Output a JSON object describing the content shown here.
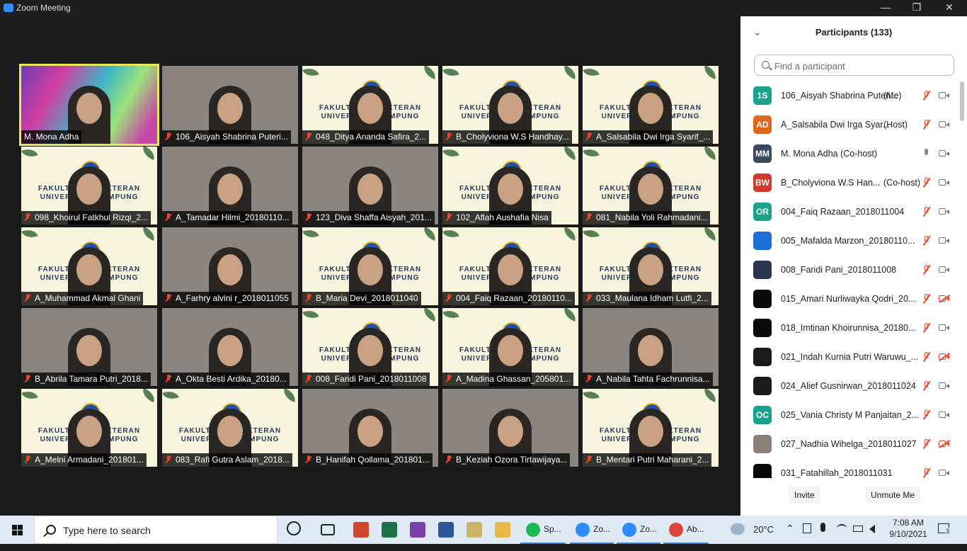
{
  "window": {
    "title": "Zoom Meeting",
    "controls": [
      "—",
      "❐",
      "✕"
    ]
  },
  "tiles": [
    {
      "name": "M. Mona Adha",
      "kind": "speaker",
      "muted": false
    },
    {
      "name": "106_Aisyah Shabrina Puteri...",
      "kind": "cam",
      "muted": true
    },
    {
      "name": "048_Ditya Ananda Safira_2...",
      "kind": "fk",
      "muted": true
    },
    {
      "name": "B_Cholyviona W.S Handhay...",
      "kind": "fk",
      "muted": true
    },
    {
      "name": "A_Salsabila Dwi Irga Syarif_...",
      "kind": "fk",
      "muted": true
    },
    {
      "name": "098_Khoirul Fatkhul Rizqi_2...",
      "kind": "fk",
      "muted": true
    },
    {
      "name": "A_Tamadar Hilmi_20180110...",
      "kind": "cam",
      "muted": true
    },
    {
      "name": "123_Diva Shaffa Aisyah_201...",
      "kind": "cam",
      "muted": true
    },
    {
      "name": "102_Aflah Aushafia Nisa",
      "kind": "fk",
      "muted": true
    },
    {
      "name": "081_Nabila Yoli Rahmadani...",
      "kind": "fk",
      "muted": true
    },
    {
      "name": "A_Muhammad Akmal Ghani",
      "kind": "fk",
      "muted": true
    },
    {
      "name": "A_Farhry alvini r_2018011055",
      "kind": "cam",
      "muted": true
    },
    {
      "name": "B_Maria Devi_2018011040",
      "kind": "fk",
      "muted": true
    },
    {
      "name": "004_Faiq Razaan_20180110...",
      "kind": "fk",
      "muted": true
    },
    {
      "name": "033_Maulana Idham Lutfi_2...",
      "kind": "fk",
      "muted": true
    },
    {
      "name": "B_Abrila Tamara Putri_2018...",
      "kind": "cam",
      "muted": true
    },
    {
      "name": "A_Okta Besti Ardika_20180...",
      "kind": "cam",
      "muted": true
    },
    {
      "name": "008_Faridi Pani_2018011008",
      "kind": "fk",
      "muted": true
    },
    {
      "name": "A_Madina Ghassan_205801...",
      "kind": "fk",
      "muted": true
    },
    {
      "name": "A_Nabila Tahta Fachrunnisa...",
      "kind": "cam",
      "muted": true
    },
    {
      "name": "A_Melni Armadani_201801...",
      "kind": "fk",
      "muted": true
    },
    {
      "name": "083_Rafi Gutra Aslam_2018...",
      "kind": "fk",
      "muted": true
    },
    {
      "name": "B_Hanifah Qollama_201801...",
      "kind": "cam",
      "muted": true
    },
    {
      "name": "B_Keziah Ozora Tirtawijaya...",
      "kind": "cam",
      "muted": true
    },
    {
      "name": "B_Mentari Putri Maharani_2...",
      "kind": "fk",
      "muted": true
    }
  ],
  "fk_text": {
    "line1": "FAKULTAS KEDOKTERAN",
    "line2": "UNIVERSITAS LAMPUNG"
  },
  "panel": {
    "title": "Participants (133)",
    "search_placeholder": "Find a participant",
    "participants": [
      {
        "initials": "1S",
        "color": "#1aa38c",
        "name": "106_Aisyah Shabrina Puteri...",
        "role": "(Me)",
        "mic": "muted",
        "cam": "on"
      },
      {
        "initials": "AD",
        "color": "#e0661b",
        "name": "A_Salsabila Dwi Irga Syar...",
        "role": "(Host)",
        "mic": "muted",
        "cam": "on"
      },
      {
        "initials": "MM",
        "color": "#3a4a5e",
        "name": "M. Mona Adha (Co-host)",
        "role": "",
        "mic": "on",
        "cam": "on"
      },
      {
        "initials": "BW",
        "color": "#d23a2c",
        "name": "B_Cholyviona W.S Han...",
        "role": "(Co-host)",
        "mic": "muted",
        "cam": "on"
      },
      {
        "initials": "OR",
        "color": "#1aa38c",
        "name": "004_Faiq Razaan_2018011004",
        "role": "",
        "mic": "muted",
        "cam": "on"
      },
      {
        "initials": "",
        "color": "#1f6fd6",
        "name": "005_Mafalda Marzon_20180110...",
        "role": "",
        "mic": "muted",
        "cam": "on"
      },
      {
        "initials": "",
        "color": "#2a3550",
        "name": "008_Faridi Pani_2018011008",
        "role": "",
        "mic": "muted",
        "cam": "on"
      },
      {
        "initials": "",
        "color": "#0a0a0a",
        "name": "015_Amari Nurliwayka Qodri_20...",
        "role": "",
        "mic": "muted",
        "cam": "off"
      },
      {
        "initials": "",
        "color": "#0a0a0a",
        "name": "018_Imtinan Khoirunnisa_20180...",
        "role": "",
        "mic": "muted",
        "cam": "on"
      },
      {
        "initials": "",
        "color": "#1a1a1a",
        "name": "021_Indah Kurnia Putri Waruwu_...",
        "role": "",
        "mic": "muted",
        "cam": "off"
      },
      {
        "initials": "",
        "color": "#1a1a1a",
        "name": "024_Alief Gusnirwan_2018011024",
        "role": "",
        "mic": "muted",
        "cam": "on"
      },
      {
        "initials": "OC",
        "color": "#1aa38c",
        "name": "025_Vania Christy M Panjaitan_2...",
        "role": "",
        "mic": "muted",
        "cam": "on"
      },
      {
        "initials": "",
        "color": "#8a7e76",
        "name": "027_Nadhia Wihelga_2018011027",
        "role": "",
        "mic": "muted",
        "cam": "off"
      },
      {
        "initials": "",
        "color": "#0a0a0a",
        "name": "031_Fatahillah_2018011031",
        "role": "",
        "mic": "muted",
        "cam": "on"
      }
    ],
    "invite_label": "Invite",
    "unmute_label": "Unmute Me"
  },
  "taskbar": {
    "search_text": "Type here to search",
    "apps": [
      {
        "label": "Sp...",
        "color": "#1db954"
      },
      {
        "label": "Zo...",
        "color": "#2d8cff"
      },
      {
        "label": "Zo...",
        "color": "#2d8cff"
      },
      {
        "label": "Ab...",
        "color": "#db4437"
      }
    ],
    "weather": "20°C",
    "time": "7:08 AM",
    "date": "9/10/2021",
    "notifications": "3"
  }
}
